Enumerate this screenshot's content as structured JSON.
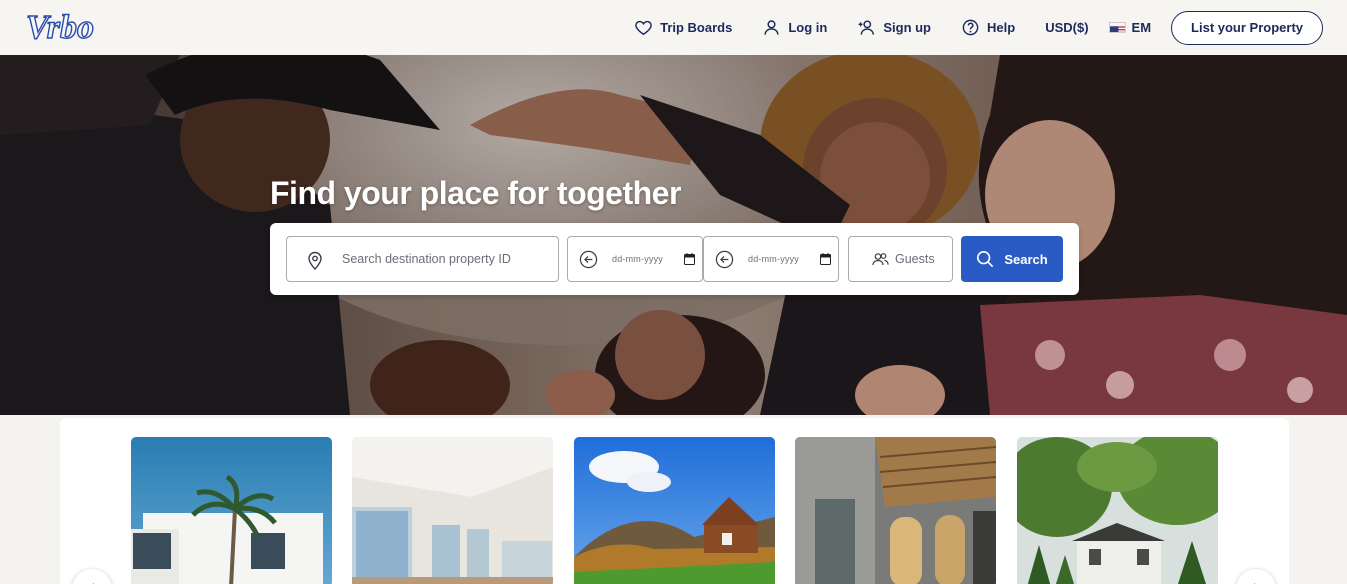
{
  "brand": {
    "logo_text": "Vrbo",
    "accent": "#2a5bc4",
    "navy": "#1b2a5b"
  },
  "nav": {
    "trip_boards": "Trip Boards",
    "log_in": "Log in",
    "sign_up": "Sign up",
    "help": "Help",
    "currency": "USD($)",
    "language": "EM",
    "list_property": "List your Property"
  },
  "hero": {
    "title": "Find your place for together"
  },
  "search": {
    "destination_placeholder": "Search destination property ID",
    "checkin_placeholder": "dd-mm-yyyy",
    "checkout_placeholder": "dd-mm-yyyy",
    "guests_placeholder": "Guests",
    "button_label": "Search"
  },
  "properties": [
    {
      "name": "modern-white-villa-palm"
    },
    {
      "name": "bright-apartment-interior"
    },
    {
      "name": "mountain-cabin"
    },
    {
      "name": "industrial-loft-courtyard"
    },
    {
      "name": "forest-cottage"
    }
  ]
}
